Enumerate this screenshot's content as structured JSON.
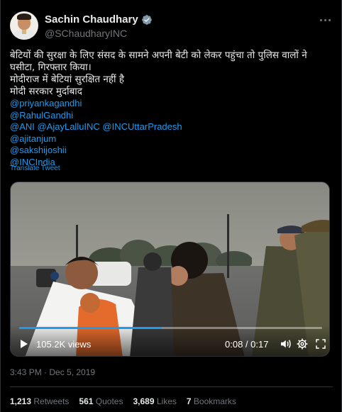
{
  "author": {
    "display_name": "Sachin Chaudhary",
    "handle": "@SChaudharyINC"
  },
  "tweet": {
    "lines": [
      "बेटियों की सुरक्षा के लिए संसद के सामने अपनी बेटी को लेकर पहुंचा तो पुलिस वालों ने",
      "घसीटा, गिरफ्तार किया।",
      "मोदीराज में बेटियां सुरक्षित नहीं है",
      "मोदी सरकार मुर्दाबाद"
    ],
    "mentions": [
      "@priyankagandhi",
      "@RahulGandhi",
      "@ANI @AjayLalluINC @INCUttarPradesh",
      "@ajitanjum",
      "@sakshijoshii",
      "@INCIndia"
    ],
    "translate_label": "Translate Tweet"
  },
  "video": {
    "views": "105.2K views",
    "time": "0:08 / 0:17",
    "progress": 0.47
  },
  "meta": {
    "timestamp": "3:43 PM · Dec 5, 2019"
  },
  "stats": {
    "retweets_count": "1,213",
    "retweets_label": "Retweets",
    "quotes_count": "561",
    "quotes_label": "Quotes",
    "likes_count": "3,689",
    "likes_label": "Likes",
    "bookmarks_count": "7",
    "bookmarks_label": "Bookmarks"
  },
  "icons": {
    "verified": "verified-badge-icon",
    "more": "more-icon",
    "play": "play-icon",
    "volume": "volume-icon",
    "settings": "gear-icon",
    "fullscreen": "fullscreen-icon"
  },
  "colors": {
    "link": "#1d9bf0",
    "muted": "#71767b",
    "text": "#e7e9ea",
    "background": "#000000"
  }
}
